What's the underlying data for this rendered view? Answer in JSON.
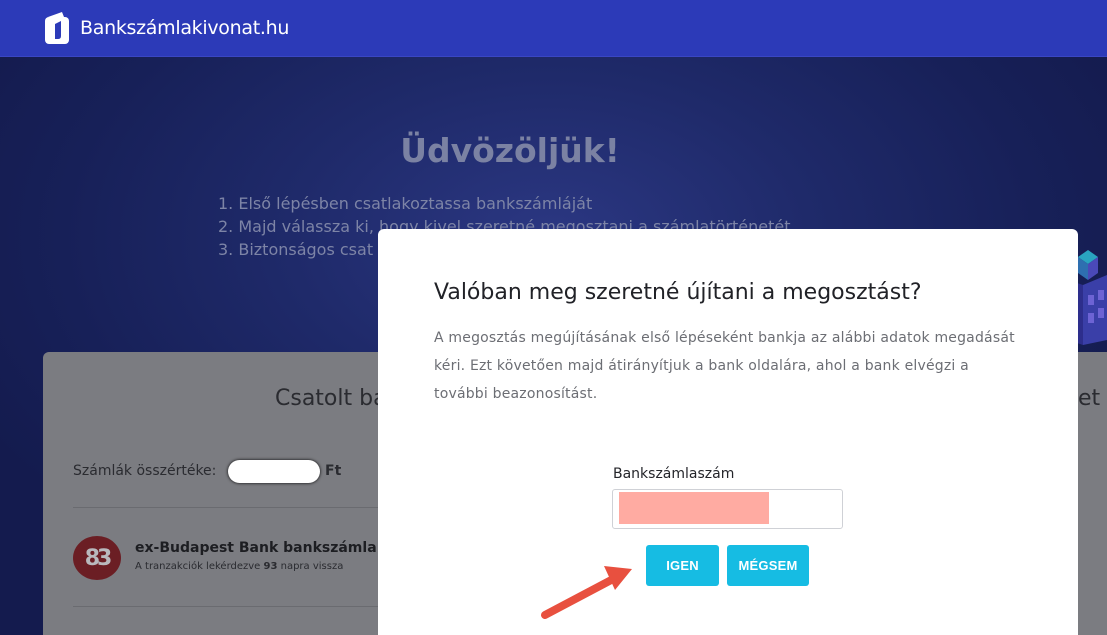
{
  "header": {
    "site_name": "Bankszámlakivonat.hu"
  },
  "hero": {
    "title": "Üdvözöljük!",
    "steps": [
      "1. Első lépésben csatlakoztassa bankszámláját",
      "2. Majd válassza ki, hogy kivel szeretné megosztani a számlatörténetét",
      "3. Biztonságos csat"
    ]
  },
  "card": {
    "title": "Csatolt ba",
    "title_right": "et",
    "total_label": "Számlák összértéke:",
    "total_currency": "Ft",
    "bank": {
      "logo_text": "83",
      "name": "ex-Budapest Bank bankszámla",
      "sub_prefix": "A tranzakciók lekérdezve ",
      "sub_days": "93",
      "sub_suffix": " napra vissza"
    }
  },
  "modal": {
    "title": "Valóban meg szeretné újítani a megosztást?",
    "text": "A megosztás megújításának első lépéseként bankja az alábbi adatok megadását kéri. Ezt követően majd átirányítjuk a bank oldalára, ahol a bank elvégzi a további beazonosítást.",
    "field_label": "Bankszámlaszám",
    "yes_label": "IGEN",
    "no_label": "MÉGSEM"
  },
  "colors": {
    "topbar": "#2c3ab8",
    "button": "#16bce3",
    "annotation_arrow": "#e8503f"
  }
}
